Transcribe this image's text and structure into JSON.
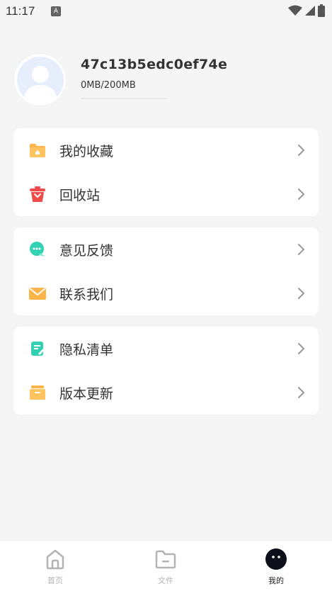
{
  "status_bar": {
    "time": "11:17",
    "notification_icon": "a-letter-icon",
    "signal_icons": [
      "wifi-icon",
      "cell-signal-icon",
      "battery-icon"
    ]
  },
  "profile": {
    "user_id": "47c13b5edc0ef74e",
    "storage_text": "0MB/200MB",
    "storage_used_fraction": 0.0,
    "avatar_icon": "default-user-icon"
  },
  "menu_groups": [
    {
      "items": [
        {
          "label": "我的收藏",
          "icon": "folder-favorites-icon",
          "icon_color": "#ffb44a"
        },
        {
          "label": "回收站",
          "icon": "trash-icon",
          "icon_color": "#f04b4b"
        }
      ]
    },
    {
      "items": [
        {
          "label": "意见反馈",
          "icon": "chat-feedback-icon",
          "icon_color": "#33d1b4"
        },
        {
          "label": "联系我们",
          "icon": "envelope-icon",
          "icon_color": "#ffb44a"
        }
      ]
    },
    {
      "items": [
        {
          "label": "隐私清单",
          "icon": "document-edit-icon",
          "icon_color": "#33d1b4"
        },
        {
          "label": "版本更新",
          "icon": "update-box-icon",
          "icon_color": "#ffb44a"
        }
      ]
    }
  ],
  "tabbar": {
    "tabs": [
      {
        "label": "首页",
        "icon": "home-icon",
        "active": false
      },
      {
        "label": "文件",
        "icon": "folder-icon",
        "active": false
      },
      {
        "label": "我的",
        "icon": "profile-face-icon",
        "active": true
      }
    ]
  },
  "colors": {
    "background": "#f5f5f5",
    "card": "#ffffff",
    "accent_blue": "#3a7bfd",
    "tab_inactive": "#b3b3b3",
    "tab_active": "#222222"
  }
}
